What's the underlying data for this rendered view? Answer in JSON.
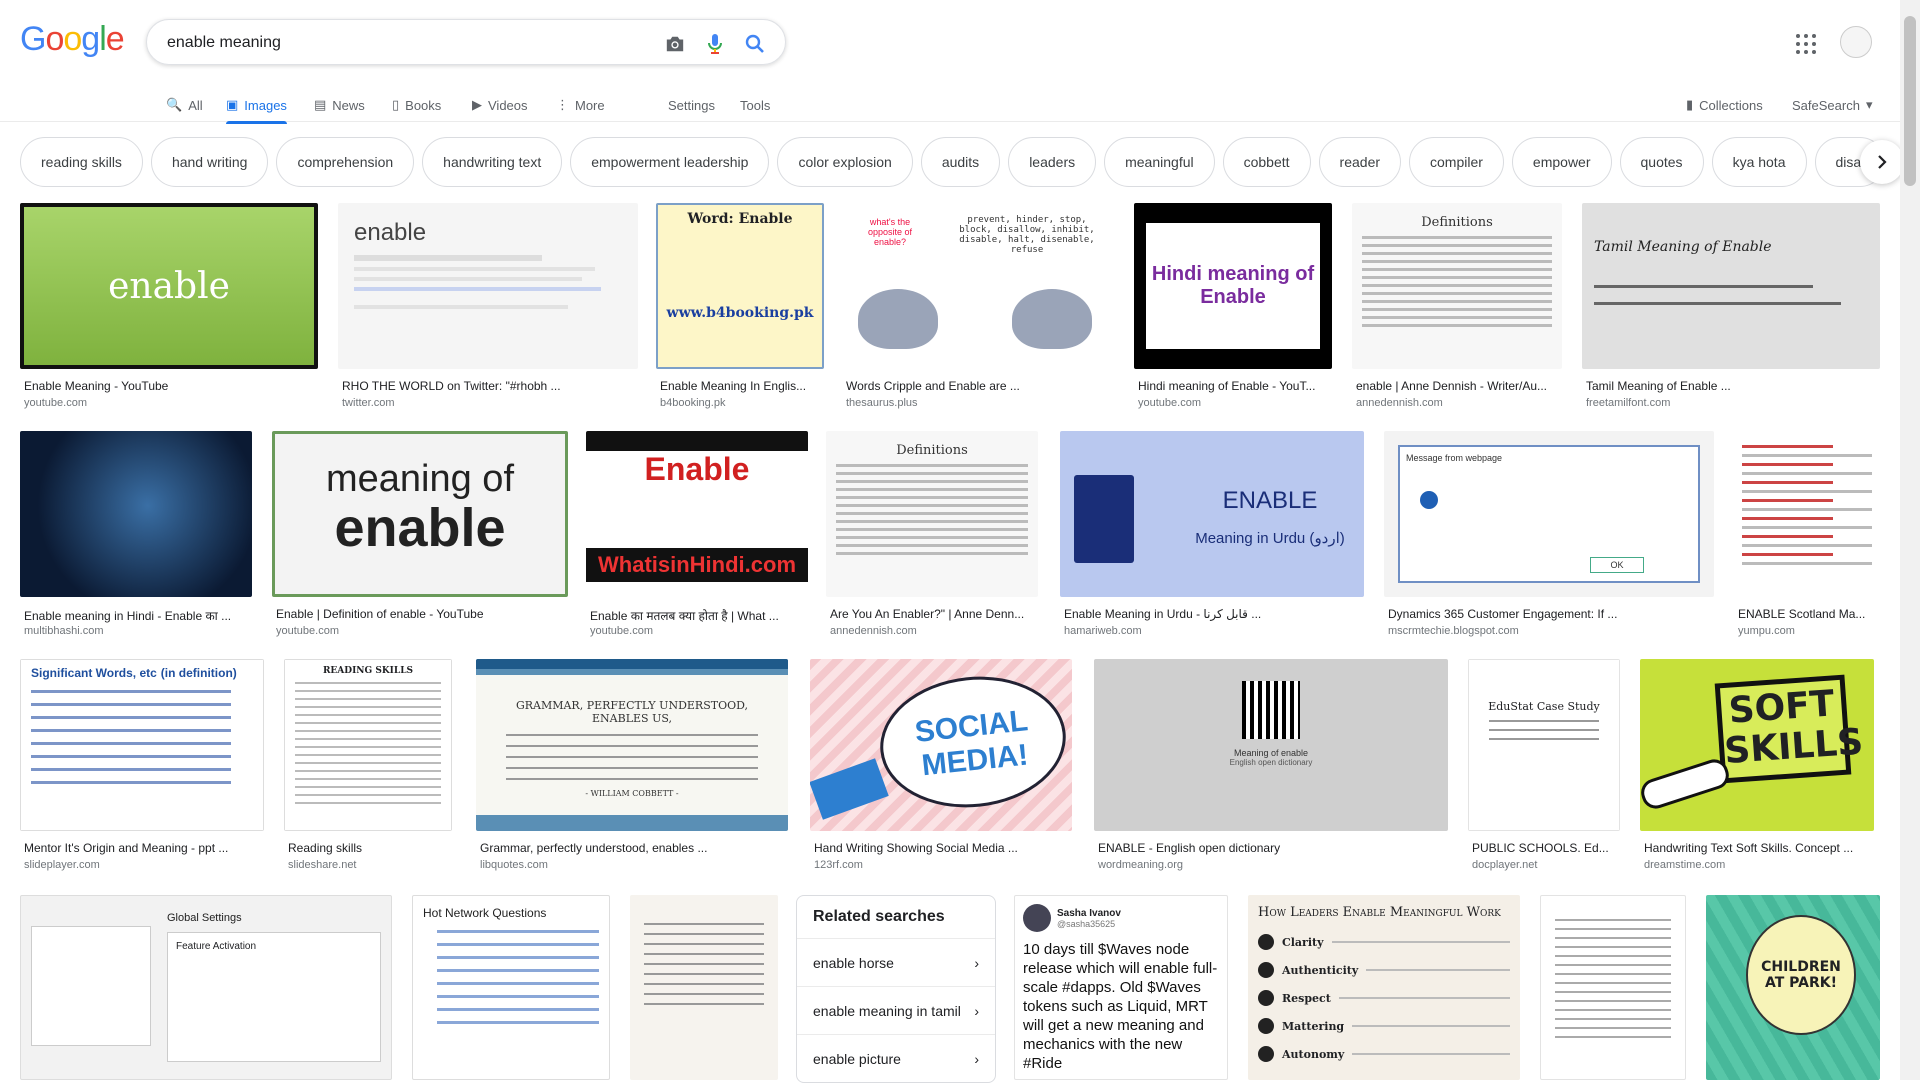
{
  "logo": {
    "text": "Google"
  },
  "search": {
    "value": "enable meaning"
  },
  "tabs": [
    {
      "label": "All"
    },
    {
      "label": "Images"
    },
    {
      "label": "News"
    },
    {
      "label": "Books"
    },
    {
      "label": "Videos"
    },
    {
      "label": "More"
    },
    {
      "label": "Settings"
    },
    {
      "label": "Tools"
    }
  ],
  "right_tools": {
    "collections": "Collections",
    "safesearch": "SafeSearch"
  },
  "chips": [
    "reading skills",
    "hand writing",
    "comprehension",
    "handwriting text",
    "empowerment leadership",
    "color explosion",
    "audits",
    "leaders",
    "meaningful",
    "cobbett",
    "reader",
    "compiler",
    "empower",
    "quotes",
    "kya hota",
    "disal"
  ],
  "results": [
    {
      "title": "Enable Meaning - YouTube",
      "source": "youtube.com",
      "thumb_text": "enable"
    },
    {
      "title": "RHO THE WORLD on Twitter: \"#rhobh ...",
      "source": "twitter.com",
      "thumb_text": "enable"
    },
    {
      "title": "Enable Meaning In Englis...",
      "source": "b4booking.pk",
      "thumb_text": "Word: Enable",
      "thumb_sub": "www.b4booking.pk"
    },
    {
      "title": "Words Cripple and Enable are ...",
      "source": "thesaurus.plus",
      "thumb_text": "what's the opposite of enable?",
      "thumb_sub": "prevent, hinder, stop, block, disallow, inhibit, disable, halt, disenable, refuse"
    },
    {
      "title": "Hindi meaning of Enable - YouT...",
      "source": "youtube.com",
      "thumb_text": "Hindi meaning of Enable"
    },
    {
      "title": "enable | Anne Dennish - Writer/Au...",
      "source": "annedennish.com",
      "thumb_text": "Definitions"
    },
    {
      "title": "Tamil Meaning of Enable ...",
      "source": "freetamilfont.com",
      "thumb_text": "Tamil Meaning of Enable"
    },
    {
      "title": "Enable meaning in Hindi - Enable का ...",
      "source": "multibhashi.com",
      "thumb_text": ""
    },
    {
      "title": "Enable | Definition of enable - YouTube",
      "source": "youtube.com",
      "thumb_text": "meaning of",
      "thumb_sub": "enable"
    },
    {
      "title": "Enable का मतलब क्या होता है | What ...",
      "source": "youtube.com",
      "thumb_text": "Enable",
      "thumb_sub": "WhatisinHindi.com"
    },
    {
      "title": "Are You An Enabler?\" | Anne Denn...",
      "source": "annedennish.com",
      "thumb_text": "Definitions"
    },
    {
      "title": "Enable Meaning in Urdu - قابل کرنا ...",
      "source": "hamariweb.com",
      "thumb_text": "ENABLE",
      "thumb_sub": "Meaning in Urdu (اردو)"
    },
    {
      "title": "Dynamics 365 Customer Engagement: If ...",
      "source": "mscrmtechie.blogspot.com",
      "thumb_text": "Message from webpage",
      "thumb_sub": "OK"
    },
    {
      "title": "ENABLE Scotland Ma...",
      "source": "yumpu.com",
      "thumb_text": ""
    },
    {
      "title": "Mentor It's Origin and Meaning - ppt ...",
      "source": "slideplayer.com",
      "thumb_text": "Significant Words, etc",
      "thumb_sub": "(in definition)"
    },
    {
      "title": "Reading skills",
      "source": "slideshare.net",
      "thumb_text": "READING SKILLS"
    },
    {
      "title": "Grammar, perfectly understood, enables ...",
      "source": "libquotes.com",
      "thumb_text": "GRAMMAR, PERFECTLY UNDERSTOOD, ENABLES US,",
      "thumb_sub": "- WILLIAM COBBETT -"
    },
    {
      "title": "Hand Writing Showing Social Media ...",
      "source": "123rf.com",
      "thumb_text": "SOCIAL",
      "thumb_sub": "MEDIA!"
    },
    {
      "title": "ENABLE - English open dictionary",
      "source": "wordmeaning.org",
      "thumb_text": "Meaning of enable",
      "thumb_sub": "English open dictionary"
    },
    {
      "title": "PUBLIC SCHOOLS. Ed...",
      "source": "docplayer.net",
      "thumb_text": "EduStat Case Study"
    },
    {
      "title": "Handwriting Text Soft Skills. Concept ...",
      "source": "dreamstime.com",
      "thumb_text": "SOFT",
      "thumb_sub": "SKILLS"
    }
  ],
  "bottom": {
    "global_settings": "Global Settings",
    "feature_activation": "Feature Activation",
    "hot_network": "Hot Network Questions",
    "related_title": "Related searches",
    "related": [
      "enable horse",
      "enable meaning in tamil",
      "enable picture"
    ],
    "tweet_name": "Sasha Ivanov",
    "tweet_handle": "@sasha35625",
    "tweet_text": "10 days till $Waves node release which will enable full-scale #dapps.  Old $Waves tokens such as Liquid,  MRT will get a new meaning and  mechanics with the new #Ride",
    "leaders_title": "How Leaders Enable Meaningful Work",
    "leaders_items": [
      "Clarity",
      "Authenticity",
      "Respect",
      "Mattering",
      "Autonomy"
    ],
    "children_text": "CHILDREN AT PARK!"
  }
}
